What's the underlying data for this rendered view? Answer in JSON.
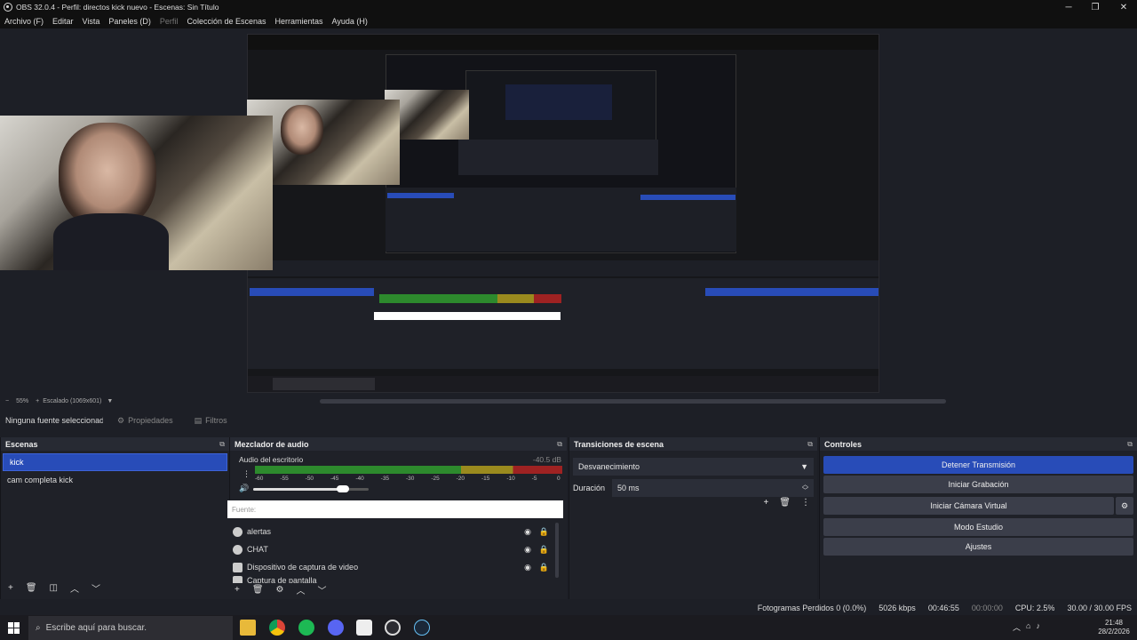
{
  "window": {
    "title": "OBS 32.0.4 - Perfil: directos kick nuevo - Escenas: Sin Título",
    "minimize_glyph": "─",
    "maximize_glyph": "❐",
    "close_glyph": "✕"
  },
  "menu": [
    "Archivo (F)",
    "Editar",
    "Vista",
    "Paneles (D)",
    "Perfil",
    "Colección de Escenas",
    "Herramientas",
    "Ayuda (H)"
  ],
  "preview": {
    "zoom": "55%",
    "zoom_minus": "−",
    "zoom_plus": "+",
    "scale_label": "Escalado (1069x601)"
  },
  "source_bar": {
    "no_source": "Ninguna fuente seleccionada",
    "properties": "Propiedades",
    "filters": "Filtros"
  },
  "scenes": {
    "title": "Escenas",
    "items": [
      "kick",
      "cam completa kick"
    ],
    "selected": "kick"
  },
  "mixer": {
    "title": "Mezclador de audio",
    "channel": "Audio del escritorio",
    "level": "-40.5 dB",
    "ticks": [
      "-60",
      "-55",
      "-50",
      "-45",
      "-40",
      "-35",
      "-30",
      "-25",
      "-20",
      "-15",
      "-10",
      "-5",
      "0"
    ],
    "volume_fraction": 0.78,
    "filter_placeholder": "Fuente:",
    "sources": [
      "alertas",
      "CHAT",
      "Dispositivo de captura de video",
      "Captura de pantalla"
    ]
  },
  "transitions": {
    "title": "Transiciones de escena",
    "selected": "Desvanecimiento",
    "duration_label": "Duración",
    "duration_value": "50 ms"
  },
  "controls": {
    "title": "Controles",
    "stop_stream": "Detener Transmisión",
    "start_recording": "Iniciar Grabación",
    "start_virtual_cam": "Iniciar Cámara Virtual",
    "studio_mode": "Modo Estudio",
    "settings": "Ajustes"
  },
  "status": {
    "dropped_frames": "Fotogramas Perdidos 0 (0.0%)",
    "bitrate": "5026 kbps",
    "stream_time": "00:46:55",
    "rec_time": "00:00:00",
    "cpu": "CPU: 2.5%",
    "fps": "30.00 / 30.00 FPS"
  },
  "taskbar": {
    "search_placeholder": "Escribe aquí para buscar.",
    "time": "21:48",
    "date": "28/2/2026"
  },
  "colors": {
    "accent": "#284cb8",
    "meter_green": "#2d8a2d",
    "meter_yellow": "#9a8a1e",
    "meter_red": "#9e2222"
  }
}
